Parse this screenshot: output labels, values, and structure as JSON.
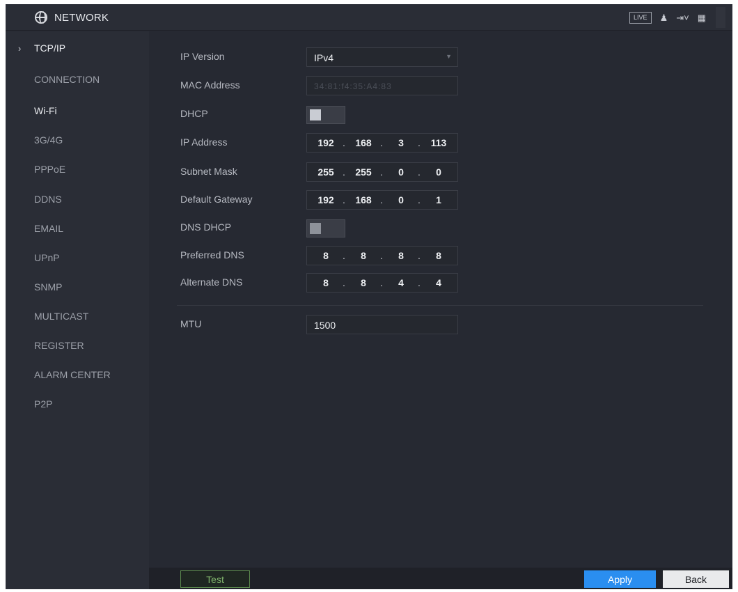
{
  "header": {
    "title": "NETWORK",
    "icons": [
      "globe-icon",
      "live-button",
      "user-icon",
      "logout-icon",
      "grid-icon"
    ],
    "live_label": "LIVE"
  },
  "sidebar": {
    "items": [
      {
        "label": "TCP/IP",
        "active": true
      },
      {
        "label": "CONNECTION"
      },
      {
        "label": "Wi-Fi"
      },
      {
        "label": "3G/4G"
      },
      {
        "label": "PPPoE"
      },
      {
        "label": "DDNS"
      },
      {
        "label": "EMAIL"
      },
      {
        "label": "UPnP"
      },
      {
        "label": "SNMP"
      },
      {
        "label": "MULTICAST"
      },
      {
        "label": "REGISTER"
      },
      {
        "label": "ALARM CENTER"
      },
      {
        "label": "P2P"
      }
    ]
  },
  "form": {
    "ip_version": {
      "label": "IP Version",
      "value": "IPv4"
    },
    "mac_address": {
      "label": "MAC Address",
      "value": "34:81:f4:35:A4:83"
    },
    "dhcp": {
      "label": "DHCP",
      "enabled": false
    },
    "ip_address": {
      "label": "IP Address",
      "octets": [
        "192",
        "168",
        "3",
        "113"
      ]
    },
    "subnet_mask": {
      "label": "Subnet Mask",
      "octets": [
        "255",
        "255",
        "0",
        "0"
      ]
    },
    "default_gateway": {
      "label": "Default Gateway",
      "octets": [
        "192",
        "168",
        "0",
        "1"
      ]
    },
    "dns_dhcp": {
      "label": "DNS DHCP",
      "enabled": false
    },
    "preferred_dns": {
      "label": "Preferred DNS",
      "octets": [
        "8",
        "8",
        "8",
        "8"
      ]
    },
    "alternate_dns": {
      "label": "Alternate DNS",
      "octets": [
        "8",
        "8",
        "4",
        "4"
      ]
    },
    "mtu": {
      "label": "MTU",
      "value": "1500"
    }
  },
  "footer": {
    "test_label": "Test",
    "apply_label": "Apply",
    "back_label": "Back"
  },
  "colors": {
    "background": "#262932",
    "sidebar": "#2a2d36",
    "apply": "#2a8ef0",
    "back": "#e9eaec",
    "test_border": "#5b8a4d"
  }
}
